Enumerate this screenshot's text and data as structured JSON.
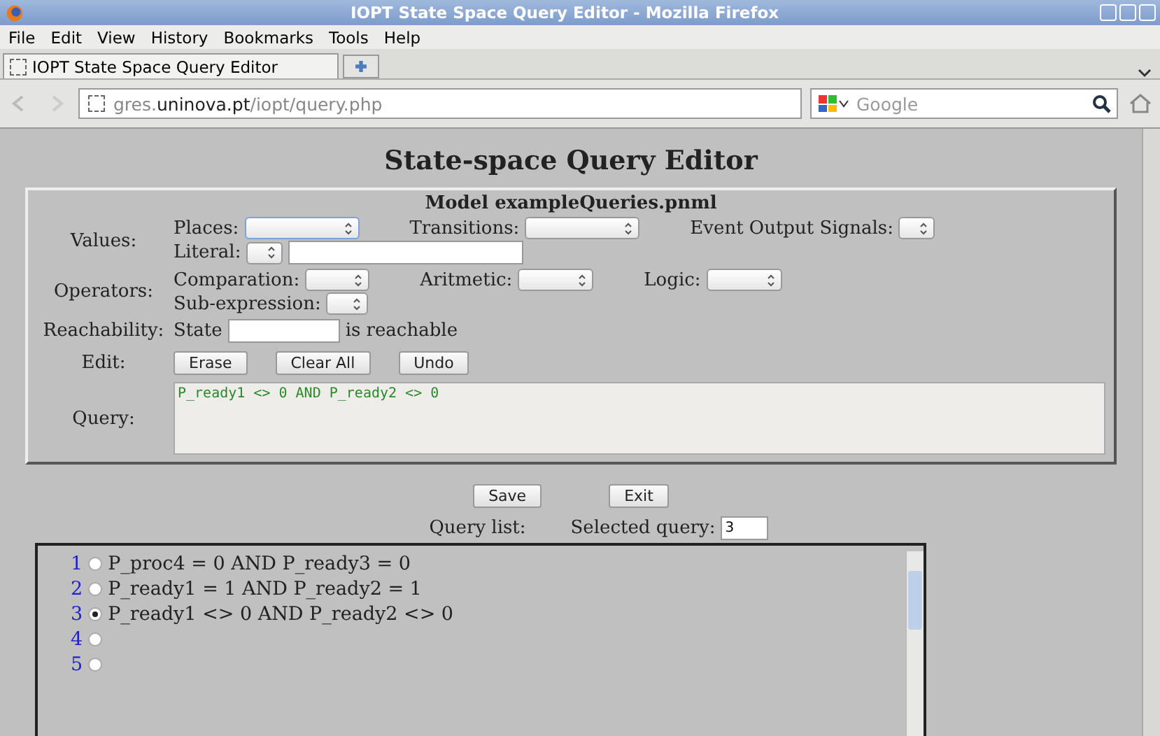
{
  "window": {
    "title": "IOPT State Space Query Editor - Mozilla Firefox"
  },
  "menu": [
    "File",
    "Edit",
    "View",
    "History",
    "Bookmarks",
    "Tools",
    "Help"
  ],
  "tabs": [
    {
      "label": "IOPT State Space Query Editor",
      "selected": true
    }
  ],
  "address": {
    "domain_pre": "gres.",
    "domain": "uninova.pt",
    "path": "/iopt/query.php"
  },
  "search": {
    "placeholder": "Google"
  },
  "page": {
    "heading": "State-space Query Editor",
    "model": "Model exampleQueries.pnml",
    "values_label": "Values:",
    "places": "Places:",
    "transitions": "Transitions:",
    "signals": "Event Output Signals:",
    "literal": "Literal:",
    "operators_label": "Operators:",
    "comparation": "Comparation:",
    "aritmetic": "Aritmetic:",
    "logic": "Logic:",
    "subexpression": "Sub-expression:",
    "reachability_label": "Reachability:",
    "state": "State",
    "reachable": "is reachable",
    "edit_label": "Edit:",
    "edit_buttons": [
      "Erase",
      "Clear All",
      "Undo"
    ],
    "query_label": "Query:",
    "query": "P_ready1 <> 0 AND P_ready2 <> 0",
    "actions": [
      "Save",
      "Exit"
    ],
    "query_list_label": "Query list:",
    "selected_label": "Selected query:",
    "selected_value": "3",
    "queries": [
      {
        "number": "1",
        "text": "P_proc4 = 0 AND P_ready3 = 0",
        "selected": false
      },
      {
        "number": "2",
        "text": "P_ready1 = 1 AND P_ready2 = 1",
        "selected": false
      },
      {
        "number": "3",
        "text": "P_ready1 <> 0 AND P_ready2 <> 0",
        "selected": true
      },
      {
        "number": "4",
        "selected": false
      },
      {
        "number": "5",
        "selected": false
      }
    ]
  }
}
